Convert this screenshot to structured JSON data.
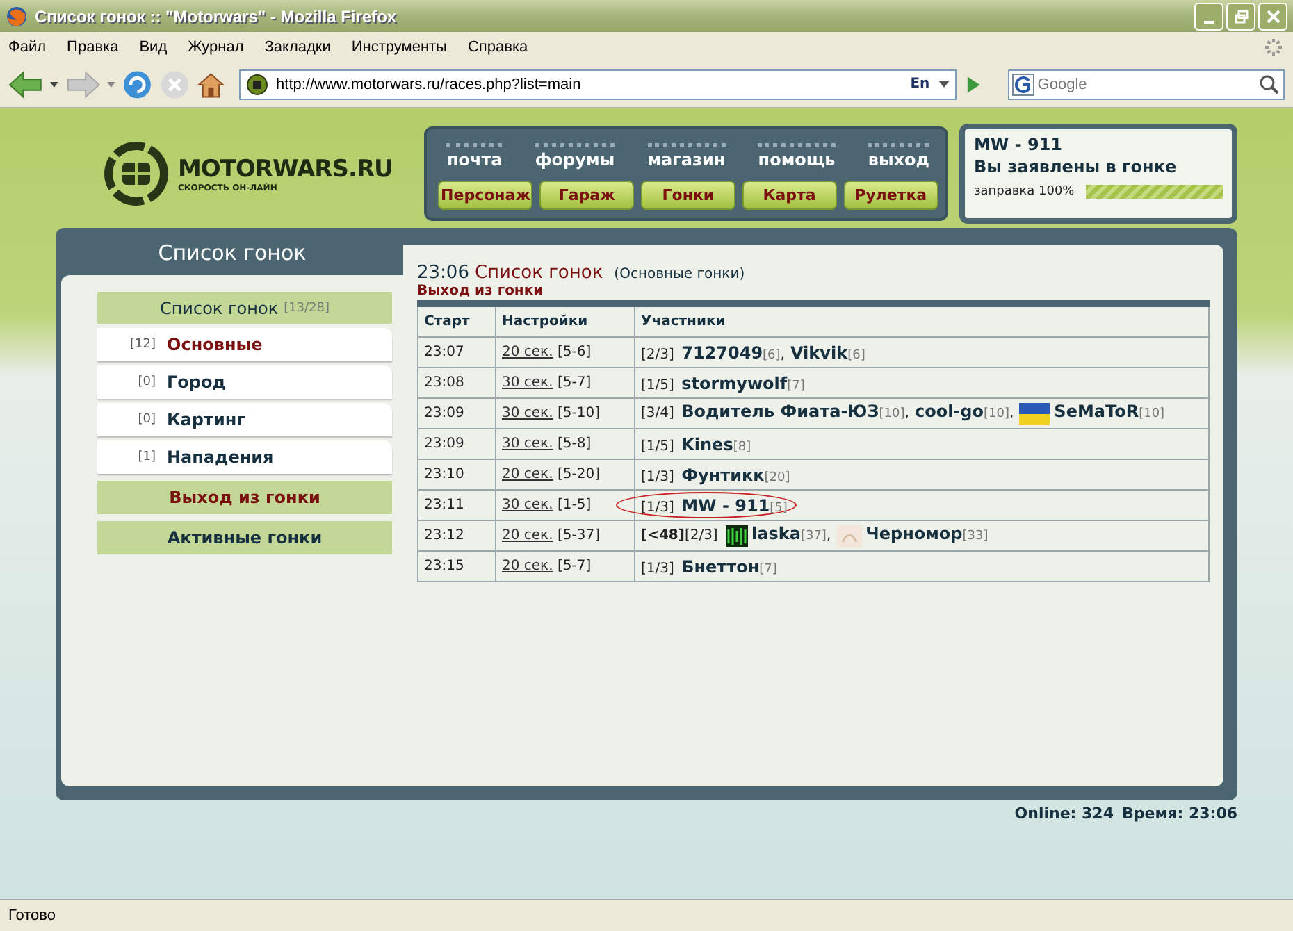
{
  "window": {
    "title": "Список гонок :: \"Motorwars\" - Mozilla Firefox"
  },
  "menu": [
    "Файл",
    "Правка",
    "Вид",
    "Журнал",
    "Закладки",
    "Инструменты",
    "Справка"
  ],
  "toolbar": {
    "url": "http://www.motorwars.ru/races.php?list=main",
    "language": "En",
    "search_placeholder": "Google"
  },
  "site": {
    "logo": "MOTORWARS.RU",
    "tagline": "СКОРОСТЬ ОН-ЛАЙН",
    "nav_links": [
      "почта",
      "форумы",
      "магазин",
      "помощь",
      "выход"
    ],
    "nav_buttons": [
      "Персонаж",
      "Гараж",
      "Гонки",
      "Карта",
      "Рулетка"
    ],
    "user": {
      "name": "MW - 911",
      "status": "Вы заявлены в гонке",
      "fuel_label": "заправка 100%",
      "level": 1.0
    }
  },
  "sidebar": {
    "title": "Список гонок",
    "header": {
      "label": "Список гонок",
      "count": "[13/28]"
    },
    "items": [
      {
        "count": "[12]",
        "label": "Основные",
        "selected": true
      },
      {
        "count": "[0]",
        "label": "Город",
        "selected": false
      },
      {
        "count": "[0]",
        "label": "Картинг",
        "selected": false
      },
      {
        "count": "[1]",
        "label": "Нападения",
        "selected": false
      }
    ],
    "actions": [
      {
        "label": "Выход из гонки",
        "kind": "exit"
      },
      {
        "label": "Активные гонки",
        "kind": "normal"
      }
    ]
  },
  "content": {
    "time": "23:06",
    "title": "Список гонок",
    "subtitle": "(Основные гонки)",
    "exit_link": "Выход из гонки",
    "table": {
      "columns": [
        "Старт",
        "Настройки",
        "Участники"
      ],
      "rows": [
        {
          "start": "23:07",
          "timeout": "20 сек.",
          "range": "[5-6]",
          "highlighted": false,
          "slots": "[2/3]",
          "players": [
            {
              "name": "7127049",
              "level": "[6]",
              "kind": "plain",
              "separator": ","
            },
            {
              "name": "Vikvik",
              "level": "[6]",
              "kind": "plain"
            }
          ]
        },
        {
          "start": "23:08",
          "timeout": "30 сек.",
          "range": "[5-7]",
          "highlighted": false,
          "slots": "[1/5]",
          "players": [
            {
              "name": "stormywolf",
              "level": "[7]",
              "kind": "plain"
            }
          ]
        },
        {
          "start": "23:09",
          "timeout": "30 сек.",
          "range": "[5-10]",
          "highlighted": false,
          "slots": "[3/4]",
          "players": [
            {
              "name": "Водитель Фиата-ЮЗ",
              "level": "[10]",
              "kind": "plain",
              "separator": ","
            },
            {
              "name": "cool-go",
              "level": "[10]",
              "kind": "plain",
              "separator": ","
            },
            {
              "name": "SeMaToR",
              "level": "[10]",
              "kind": "flag"
            }
          ]
        },
        {
          "start": "23:09",
          "timeout": "30 сек.",
          "range": "[5-8]",
          "highlighted": false,
          "slots": "[1/5]",
          "players": [
            {
              "name": "Kines",
              "level": "[8]",
              "kind": "plain"
            }
          ]
        },
        {
          "start": "23:10",
          "timeout": "20 сек.",
          "range": "[5-20]",
          "highlighted": false,
          "slots": "[1/3]",
          "players": [
            {
              "name": "Фунтикк",
              "level": "[20]",
              "kind": "plain"
            }
          ]
        },
        {
          "start": "23:11",
          "timeout": "30 сек.",
          "range": "[1-5]",
          "highlighted": true,
          "slots": "[1/3]",
          "players": [
            {
              "name": "MW - 911",
              "level": "[5]",
              "kind": "plain"
            }
          ]
        },
        {
          "start": "23:12",
          "timeout": "20 сек.",
          "range": "[5-37]",
          "highlighted": false,
          "slots": "**[<48]**[2/3]",
          "players": [
            {
              "name": "laska",
              "level": "[37]",
              "kind": "emblem",
              "separator": ","
            },
            {
              "name": "Черномор",
              "level": "[33]",
              "kind": "faded"
            }
          ]
        },
        {
          "start": "23:15",
          "timeout": "20 сек.",
          "range": "[5-7]",
          "highlighted": false,
          "slots": "[1/3]",
          "players": [
            {
              "name": "Бнеттон",
              "level": "[7]",
              "kind": "plain"
            }
          ]
        }
      ]
    }
  },
  "footer": {
    "online": "Online: 324",
    "time": "Время: 23:06"
  },
  "status_bar": "Готово"
}
